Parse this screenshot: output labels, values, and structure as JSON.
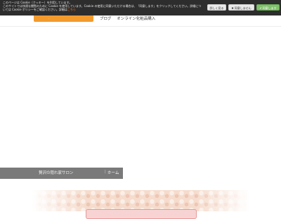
{
  "cookie": {
    "line1": "このページは Cookie（クッキー）を利用しています。",
    "line2": "このサイトでは快適な閲覧のために Cookie を使用しています。Cookie の使用に同意いただける場合は、「同意します」をクリックしてください。詳細につ",
    "line3": "いては Cookie ポリシーをご確認ください。詳細は",
    "link": "こちら",
    "buttons": {
      "detail": "詳しく見る",
      "decline": "同意しません",
      "accept": "同意します"
    }
  },
  "header": {
    "tab_text": "...",
    "nav": [
      "ブログ",
      "オンライン化粧品購入"
    ]
  },
  "page": {
    "title": "贅沢の隠れ家サロン",
    "breadcrumb_home": "ホーム"
  }
}
